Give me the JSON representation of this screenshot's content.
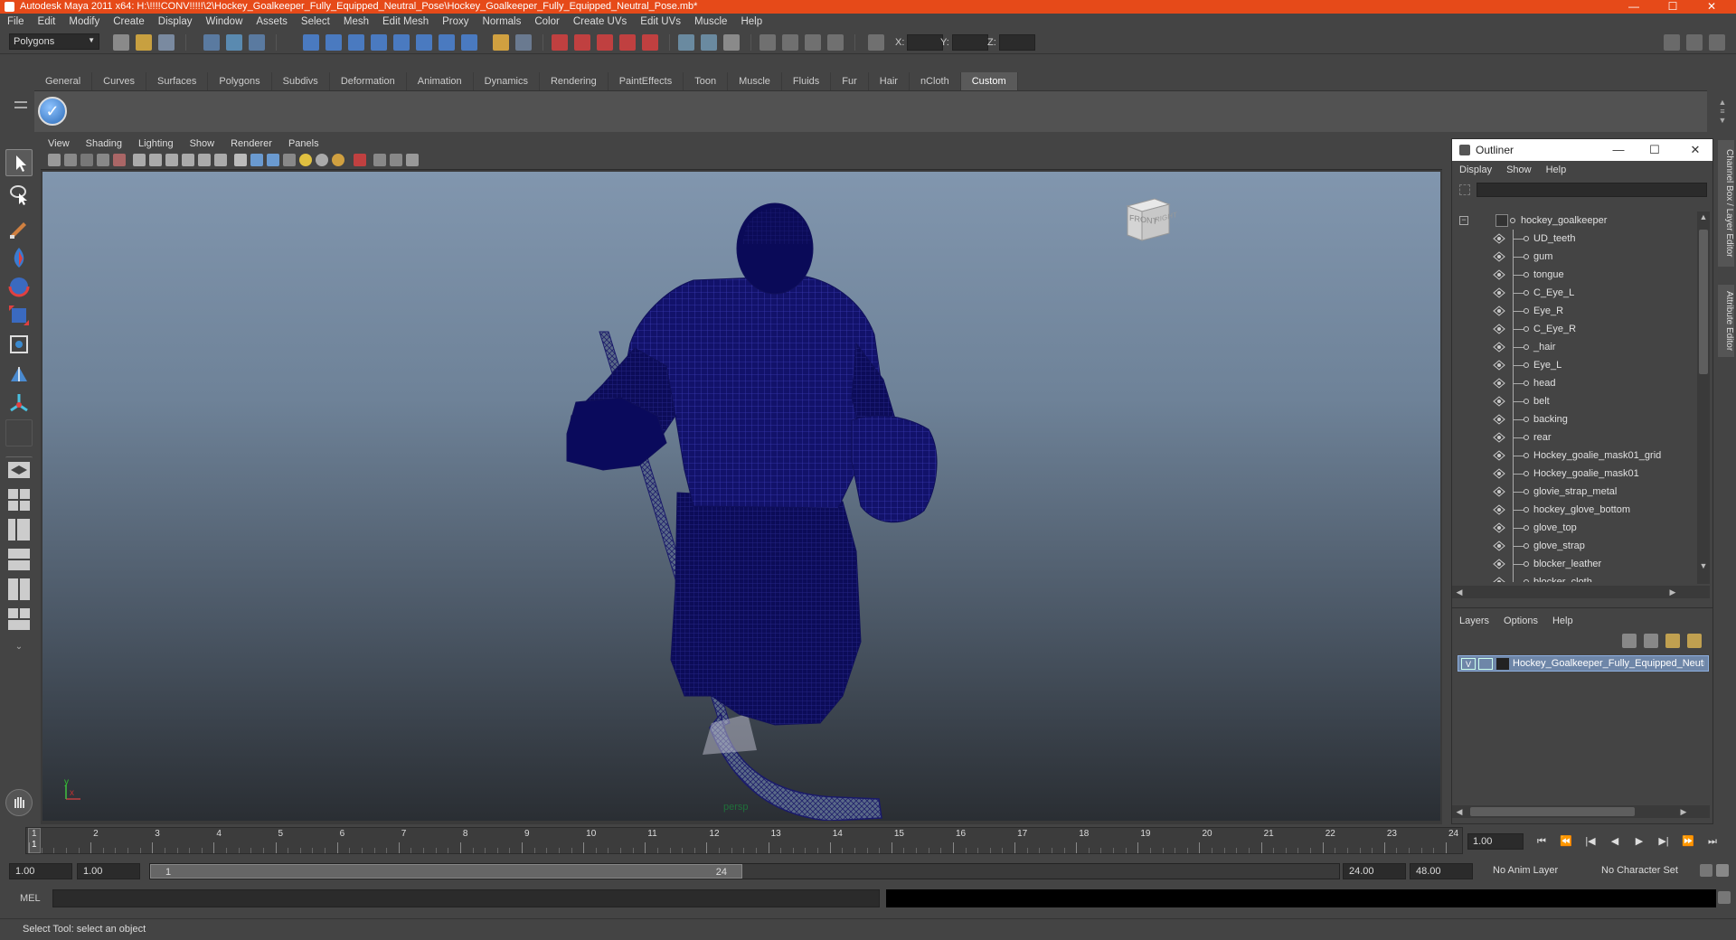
{
  "window": {
    "title": "Autodesk Maya 2011 x64: H:\\!!!!CONV!!!!!\\2\\Hockey_Goalkeeper_Fully_Equipped_Neutral_Pose\\Hockey_Goalkeeper_Fully_Equipped_Neutral_Pose.mb*",
    "title_bar_color": "#e64a19",
    "controls": [
      "—",
      "☐",
      "✕"
    ]
  },
  "menubar": [
    "File",
    "Edit",
    "Modify",
    "Create",
    "Display",
    "Window",
    "Assets",
    "Select",
    "Mesh",
    "Edit Mesh",
    "Proxy",
    "Normals",
    "Color",
    "Create UVs",
    "Edit UVs",
    "Muscle",
    "Help"
  ],
  "statusline": {
    "menuset": "Polygons",
    "x_label": "X:",
    "y_label": "Y:",
    "z_label": "Z:"
  },
  "shelf": {
    "tabs": [
      "General",
      "Curves",
      "Surfaces",
      "Polygons",
      "Subdivs",
      "Deformation",
      "Animation",
      "Dynamics",
      "Rendering",
      "PaintEffects",
      "Toon",
      "Muscle",
      "Fluids",
      "Fur",
      "Hair",
      "nCloth",
      "Custom"
    ],
    "active_tab": "Custom"
  },
  "viewport": {
    "menu": [
      "View",
      "Shading",
      "Lighting",
      "Show",
      "Renderer",
      "Panels"
    ],
    "camera_label": "persp",
    "viewcube": {
      "front": "FRONT",
      "right": "RIGHT"
    },
    "axis": {
      "x": "x",
      "y": "y"
    },
    "mesh_color": "#1a1a7a"
  },
  "outliner": {
    "title": "Outliner",
    "controls": [
      "—",
      "☐",
      "✕"
    ],
    "menu": [
      "Display",
      "Show",
      "Help"
    ],
    "root": "hockey_goalkeeper",
    "items": [
      "UD_teeth",
      "gum",
      "tongue",
      "C_Eye_L",
      "Eye_R",
      "C_Eye_R",
      "_hair",
      "Eye_L",
      "head",
      "belt",
      "backing",
      "rear",
      "Hockey_goalie_mask01_grid",
      "Hockey_goalie_mask01",
      "glovie_strap_metal",
      "hockey_glove_bottom",
      "glove_top",
      "glove_strap",
      "blocker_leather",
      "blocker_cloth"
    ]
  },
  "layers": {
    "menu": [
      "Layers",
      "Options",
      "Help"
    ],
    "layer_visible": "V",
    "layer_name": "Hockey_Goalkeeper_Fully_Equipped_Neutral_Pose"
  },
  "side_tabs": [
    "Channel Box / Layer Editor",
    "Attribute Editor"
  ],
  "timeline": {
    "ticks": [
      "1",
      "2",
      "3",
      "4",
      "5",
      "6",
      "7",
      "8",
      "9",
      "10",
      "11",
      "12",
      "13",
      "14",
      "15",
      "16",
      "17",
      "18",
      "19",
      "20",
      "21",
      "22",
      "23",
      "24"
    ],
    "current_marker": "1",
    "current_frame": "1.00",
    "playback_buttons": [
      "⏮",
      "⏪",
      "|◀",
      "◀",
      "▶",
      "▶|",
      "⏩",
      "⏭"
    ]
  },
  "range": {
    "start": "1.00",
    "playback_start": "1.00",
    "thumb_start": "1",
    "thumb_end": "24",
    "playback_end": "24.00",
    "end": "48.00",
    "anim_layer": "No Anim Layer",
    "character_set": "No Character Set"
  },
  "cmdline": {
    "label": "MEL"
  },
  "helpline": {
    "text": "Select Tool: select an object"
  }
}
